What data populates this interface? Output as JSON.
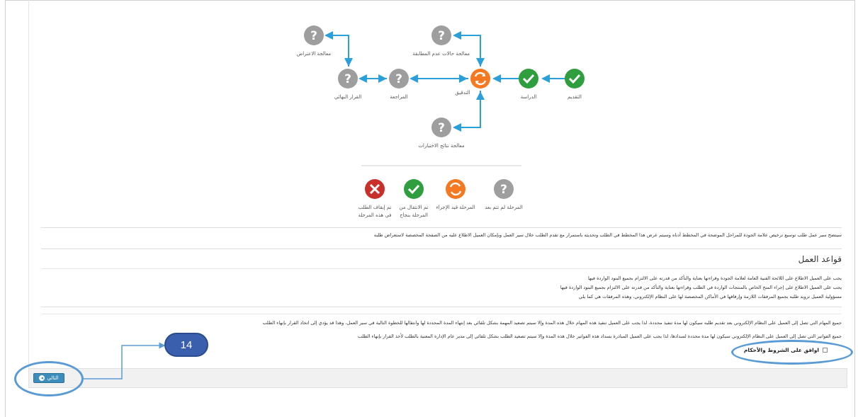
{
  "workflow": {
    "nodes": {
      "objection": {
        "label": "معالجة الاعتراض",
        "status": "pending"
      },
      "nonconformity": {
        "label": "معالجة حالات عدم المطابقة",
        "status": "pending"
      },
      "final_decision": {
        "label": "القرار النهائي",
        "status": "pending"
      },
      "review": {
        "label": "المراجعة",
        "status": "pending"
      },
      "audit": {
        "label": "التدقيق",
        "status": "in-progress"
      },
      "study": {
        "label": "الدراسة",
        "status": "done"
      },
      "submission": {
        "label": "التقديم",
        "status": "done"
      },
      "tests": {
        "label": "معالجة نتائج الاختبارات",
        "status": "pending"
      }
    },
    "colors": {
      "pending": "#9e9e9e",
      "done": "#2e9e3e",
      "in-progress": "#f47920",
      "rejected": "#c9302c",
      "arrow": "#2b9fd9"
    }
  },
  "legend": {
    "rejected": "تم إيقاف الطلب في هذه المرحلة",
    "done": "تم الانتقال من المرحلة بنجاح",
    "in_progress": "المرحلة قيد الإجراء",
    "pending": "المرحلة لم تتم بعد"
  },
  "intro_text": "سيتضح سير عمل طلب توسيع ترخيص علامة الجودة للمراحل الموضحة في المخطط أدناه وسيتم عرض هذا المخطط في الطلب وتحديثه باستمرار مع تقدم الطلب خلال سير العمل وبإمكان العميل الاطلاع عليه من الصفحة المخصصة لاستعراض طلبه",
  "rules": {
    "heading": "قواعد العمل",
    "lines": [
      "يجب على العميل الاطلاع على اللائحة الفنية العامة لعلامة الجودة وقراءتها بعناية والتأكد من قدرته على الالتزام بجميع البنود الواردة فيها",
      "يجب على العميل الاطلاع على إجراء المنح الخاص بالمنتجات الواردة في الطلب وقراءتها بعناية والتأكد من قدرته على الالتزام بجميع البنود الواردة فيها",
      "مسؤولية العميل تزويد طلبه بجميع المرفقات اللازمة وإرفاقها في الأماكن المخصصة لها على النظام الإلكتروني، وهذه المرفقات هي كما يلي"
    ],
    "notes": [
      "جميع المهام التي تصل إلى العميل على النظام الإلكتروني بعد تقديم طلبه سيكون لها مدة تنفيذ محددة، لذا يجب على العميل تنفيذ هذه المهام خلال هذه المدة وإلا سيتم تصعيد المهمة بشكل تلقائي بعد إنتهاء المدة المحددة لها وانتقالها للخطوة التالية في سير العمل، وهذا قد يؤدي إلى اتخاذ القرار بإنهاء الطلب",
      "جميع الفواتير التي تصل إلى العميل على النظام الإلكتروني سيكون لها مدة محددة لسدادها، لذا يجب على العميل المبادرة بسداد هذه الفواتير خلال هذه المدة وإلا سيتم تصعيد الطلب بشكل تلقائي إلى مدير عام الإدارة المعنية بالطلب لأخذ القرار بإنهاء الطلب"
    ]
  },
  "agree_label": "اوافق على الشروط والأحكام",
  "next_button": "التالي",
  "annotation_badge": "14"
}
